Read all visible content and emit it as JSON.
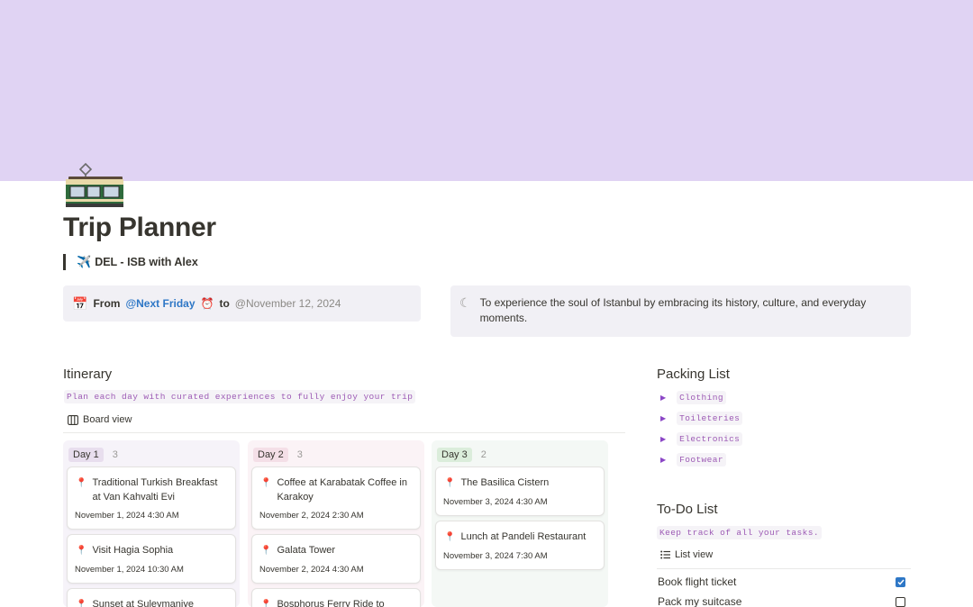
{
  "page": {
    "title": "Trip Planner",
    "subtitle": "DEL - ISB with Alex",
    "cover_color": "#e0d3f3",
    "icon": "tram-icon"
  },
  "dates": {
    "from_label": "From",
    "start": "@Next Friday",
    "to_label": "to",
    "end": "@November 12, 2024"
  },
  "goal": {
    "text": "To experience the soul of Istanbul by embracing its history, culture, and everyday moments."
  },
  "itinerary": {
    "title": "Itinerary",
    "description": "Plan each day with curated experiences to fully enjoy your trip",
    "view_label": "Board view",
    "columns": [
      {
        "name": "Day 1",
        "count": "3",
        "color": "#f6f3f9",
        "pill_color": "#e8deee",
        "cards": [
          {
            "title": "Traditional Turkish Breakfast at Van Kahvalti Evi",
            "date": "November 1, 2024 4:30 AM"
          },
          {
            "title": "Visit Hagia Sophia",
            "date": "November 1, 2024 10:30 AM"
          },
          {
            "title": "Sunset at Suleymaniye Mosque",
            "date": ""
          }
        ]
      },
      {
        "name": "Day 2",
        "count": "3",
        "color": "#fbf3f6",
        "pill_color": "#f4dfe7",
        "cards": [
          {
            "title": "Coffee at Karabatak Coffee in Karakoy",
            "date": "November 2, 2024 2:30 AM"
          },
          {
            "title": "Galata Tower",
            "date": "November 2, 2024 4:30 AM"
          },
          {
            "title": "Bosphorus Ferry Ride to",
            "date": ""
          }
        ]
      },
      {
        "name": "Day 3",
        "count": "2",
        "color": "#f4f8f5",
        "pill_color": "#dbeddb",
        "cards": [
          {
            "title": "The Basilica Cistern",
            "date": "November 3, 2024 4:30 AM"
          },
          {
            "title": "Lunch at Pandeli Restaurant",
            "date": "November 3, 2024 7:30 AM"
          }
        ]
      }
    ]
  },
  "packing": {
    "title": "Packing List",
    "items": [
      "Clothing",
      "Toileteries",
      "Electronics",
      "Footwear"
    ]
  },
  "todo": {
    "title": "To-Do List",
    "description": "Keep track of all your tasks.",
    "view_label": "List view",
    "items": [
      {
        "label": "Book flight ticket",
        "done": true
      },
      {
        "label": "Pack my suitcase",
        "done": false
      }
    ]
  },
  "colors": {
    "accent": "#2e77c6",
    "code_text": "#9d5bb5",
    "toggle": "#8b46c6",
    "pin": "#d44c47"
  }
}
